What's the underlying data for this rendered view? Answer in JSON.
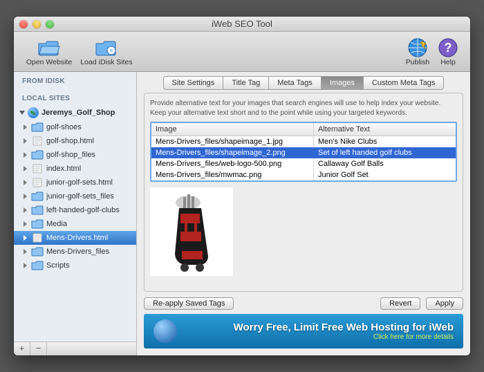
{
  "window": {
    "title": "iWeb SEO Tool"
  },
  "toolbar": {
    "open": "Open Website",
    "load": "Load iDisk Sites",
    "publish": "Publish",
    "help": "Help"
  },
  "sidebar": {
    "head1": "FROM IDISK",
    "head2": "LOCAL SITES",
    "site": "Jeremys_Golf_Shop",
    "items": [
      "golf-shoes",
      "golf-shop.html",
      "golf-shop_files",
      "index.html",
      "junior-golf-sets.html",
      "junior-golf-sets_files",
      "left-handed-golf-clubs",
      "Media",
      "Mens-Drivers.html",
      "Mens-Drivers_files",
      "Scripts"
    ],
    "selectedIndex": 8,
    "types": [
      "folder",
      "file",
      "folder",
      "file",
      "file",
      "folder",
      "folder",
      "folder",
      "file",
      "folder",
      "folder"
    ]
  },
  "tabs": {
    "items": [
      "Site Settings",
      "Title Tag",
      "Meta Tags",
      "Images",
      "Custom Meta Tags"
    ],
    "activeIndex": 3
  },
  "panel": {
    "hint": "Provide alternative text for your images that search engines will use to help index your website. Keep your alternative text short and to the point while using your targeted keywords.",
    "colA": "Image",
    "colB": "Alternative Text",
    "rows": [
      {
        "a": "Mens-Drivers_files/shapeimage_1.jpg",
        "b": "Men's Nike Clubs"
      },
      {
        "a": "Mens-Drivers_files/shapeimage_2.png",
        "b": "Set of left handed golf clubs"
      },
      {
        "a": "Mens-Drivers_files/web-logo-500.png",
        "b": "Callaway Golf Balls"
      },
      {
        "a": "Mens-Drivers_files/mwmac.png",
        "b": "Junior Golf Set"
      }
    ],
    "selectedIndex": 1
  },
  "buttons": {
    "reapply": "Re-apply Saved Tags",
    "revert": "Revert",
    "apply": "Apply"
  },
  "banner": {
    "line1": "Worry Free, Limit Free Web Hosting for iWeb",
    "line2": "Click here for more details"
  }
}
